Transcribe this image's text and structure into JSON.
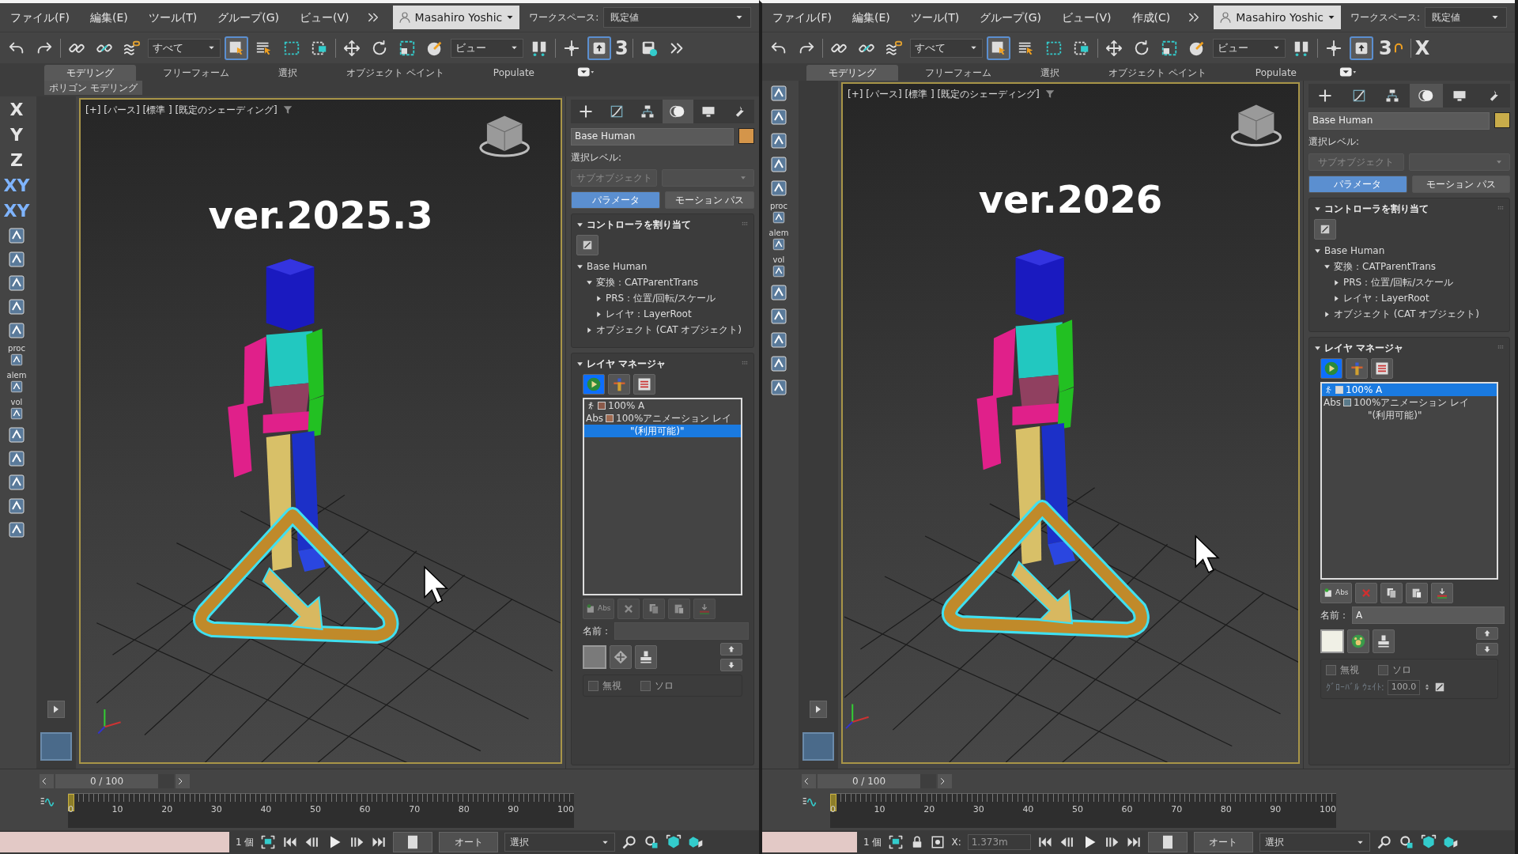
{
  "panes": [
    {
      "menu": [
        "ファイル(F)",
        "編集(E)",
        "ツール(T)",
        "グループ(G)",
        "ビュー(V)"
      ],
      "user": "Masahiro Yoshic",
      "workspace_label": "ワークスペース:",
      "workspace_value": "既定値",
      "toolbar": [
        {
          "kind": "undo"
        },
        {
          "kind": "redo"
        },
        {
          "kind": "sep"
        },
        {
          "kind": "link"
        },
        {
          "kind": "unlink"
        },
        {
          "kind": "bind"
        },
        {
          "kind": "dropdown",
          "text": "すべて"
        },
        {
          "kind": "select",
          "selected": true
        },
        {
          "kind": "selectlist",
          "selected": false
        },
        {
          "kind": "rect",
          "selected": false
        },
        {
          "kind": "window",
          "selected": false
        },
        {
          "kind": "sep"
        },
        {
          "kind": "move",
          "selected": false
        },
        {
          "kind": "rotate",
          "selected": false
        },
        {
          "kind": "scale",
          "selected": false
        },
        {
          "kind": "place",
          "selected": false
        },
        {
          "kind": "dropdown",
          "text": "ビュー"
        },
        {
          "kind": "mirror"
        },
        {
          "kind": "sep"
        },
        {
          "kind": "align"
        },
        {
          "kind": "toggle",
          "selected": true
        },
        {
          "kind": "glyph",
          "text": "3"
        },
        {
          "kind": "sep"
        },
        {
          "kind": "save"
        },
        {
          "kind": "more"
        }
      ],
      "ribbon_tabs": [
        {
          "label": "モデリング",
          "selected": true
        },
        {
          "label": "フリーフォーム",
          "selected": false
        },
        {
          "label": "選択",
          "selected": false
        },
        {
          "label": "オブジェクト ペイント",
          "selected": false
        },
        {
          "label": "Populate",
          "selected": false
        }
      ],
      "ribbon_sub": "ポリゴン モデリング",
      "side_tools": [
        {
          "kind": "axis",
          "label": "X"
        },
        {
          "kind": "axis",
          "label": "Y"
        },
        {
          "kind": "axis",
          "label": "Z"
        },
        {
          "kind": "axis",
          "label": "XY"
        },
        {
          "kind": "axis",
          "label": "XY"
        },
        {
          "kind": "tool"
        },
        {
          "kind": "tool"
        },
        {
          "kind": "tool"
        },
        {
          "kind": "tool"
        },
        {
          "kind": "tool"
        },
        {
          "kind": "script",
          "label": "proc"
        },
        {
          "kind": "script",
          "label": "alem"
        },
        {
          "kind": "script",
          "label": "vol"
        },
        {
          "kind": "tool"
        },
        {
          "kind": "tool"
        },
        {
          "kind": "tool"
        },
        {
          "kind": "tool"
        },
        {
          "kind": "tool"
        }
      ],
      "viewport": {
        "label": "[+] [パース] [標準 ] [既定のシェーディング]",
        "version": "ver.2025.3"
      },
      "command_panel": {
        "tabs": [
          {
            "kind": "create",
            "selected": false
          },
          {
            "kind": "modify",
            "selected": false
          },
          {
            "kind": "hierarchy",
            "selected": false
          },
          {
            "kind": "motion",
            "selected": true
          },
          {
            "kind": "display",
            "selected": false
          },
          {
            "kind": "utilities",
            "selected": false
          }
        ],
        "object_name": "Base Human",
        "object_swatch": {
          "color": "#d4954a"
        },
        "selection_level_label": "選択レベル:",
        "subobject_button": "サブオブジェクト",
        "mode_buttons": [
          {
            "label": "パラメータ",
            "selected": true
          },
          {
            "label": "モーション パス",
            "selected": false
          }
        ],
        "controller_rollout": {
          "title": "コントローラを割り当て",
          "tree": [
            {
              "label": "Base Human",
              "expanded": true,
              "children": [
                {
                  "label": "変換：CATParentTrans",
                  "expanded": true,
                  "children": [
                    {
                      "label": "PRS：位置/回転/スケール",
                      "expanded": false
                    },
                    {
                      "label": "レイヤ：LayerRoot",
                      "expanded": false
                    }
                  ]
                },
                {
                  "label": "オブジェクト (CAT オブジェクト)",
                  "expanded": false
                }
              ]
            }
          ]
        },
        "layer_rollout": {
          "title": "レイヤ マネージャ",
          "layers": [
            {
              "kind": "run",
              "text": "100% A",
              "color": "#8b5a4a",
              "selected": false
            },
            {
              "kind": "abs",
              "tag": "Abs",
              "text": "100%アニメーション レイ",
              "color": "#a06a50",
              "selected": false
            },
            {
              "kind": "note",
              "text": "\"(利用可能)\"",
              "selected": true
            }
          ],
          "add_tag": "Abs",
          "enabled": false,
          "name_label": "名前：",
          "layer_swatch": {
            "color": "#7a7a7a"
          },
          "checks": [
            {
              "label": "無視",
              "checked": false
            },
            {
              "label": "ソロ",
              "checked": false
            }
          ]
        }
      },
      "timeline": {
        "frame": "0 / 100",
        "level": 0,
        "ticks": [
          "0",
          "10",
          "20",
          "30",
          "40",
          "50",
          "60",
          "70",
          "80",
          "90",
          "100"
        ]
      },
      "status": {
        "selection": "1 個",
        "key_mode": "オート",
        "key_filter": "選択"
      }
    },
    {
      "menu": [
        "ファイル(F)",
        "編集(E)",
        "ツール(T)",
        "グループ(G)",
        "ビュー(V)",
        "作成(C)"
      ],
      "user": "Masahiro Yoshic",
      "workspace_label": "ワークスペース:",
      "workspace_value": "既定値",
      "toolbar": [
        {
          "kind": "undo"
        },
        {
          "kind": "redo"
        },
        {
          "kind": "sep"
        },
        {
          "kind": "link"
        },
        {
          "kind": "unlink"
        },
        {
          "kind": "bind"
        },
        {
          "kind": "dropdown",
          "text": "すべて"
        },
        {
          "kind": "select",
          "selected": true
        },
        {
          "kind": "selectlist",
          "selected": false
        },
        {
          "kind": "rect",
          "selected": false
        },
        {
          "kind": "window",
          "selected": false
        },
        {
          "kind": "sep"
        },
        {
          "kind": "move",
          "selected": false
        },
        {
          "kind": "rotate",
          "selected": false
        },
        {
          "kind": "scale",
          "selected": false
        },
        {
          "kind": "place",
          "selected": false
        },
        {
          "kind": "dropdown",
          "text": "ビュー"
        },
        {
          "kind": "mirror"
        },
        {
          "kind": "sep"
        },
        {
          "kind": "align"
        },
        {
          "kind": "toggle",
          "selected": true
        },
        {
          "kind": "snap",
          "text": "3"
        },
        {
          "kind": "sep"
        },
        {
          "kind": "glyph",
          "text": "X"
        }
      ],
      "ribbon_tabs": [
        {
          "label": "モデリング",
          "selected": true
        },
        {
          "label": "フリーフォーム",
          "selected": false
        },
        {
          "label": "選択",
          "selected": false
        },
        {
          "label": "オブジェクト ペイント",
          "selected": false
        },
        {
          "label": "Populate",
          "selected": false
        }
      ],
      "side_tools": [
        {
          "kind": "tool"
        },
        {
          "kind": "tool"
        },
        {
          "kind": "tool"
        },
        {
          "kind": "tool"
        },
        {
          "kind": "tool"
        },
        {
          "kind": "script",
          "label": "proc"
        },
        {
          "kind": "script",
          "label": "alem"
        },
        {
          "kind": "script",
          "label": "vol"
        },
        {
          "kind": "tool"
        },
        {
          "kind": "tool"
        },
        {
          "kind": "tool"
        },
        {
          "kind": "tool"
        },
        {
          "kind": "tool"
        }
      ],
      "viewport": {
        "label": "[+] [パース] [標準 ] [既定のシェーディング]",
        "version": "ver.2026"
      },
      "command_panel": {
        "tabs": [
          {
            "kind": "create",
            "selected": false
          },
          {
            "kind": "modify",
            "selected": false
          },
          {
            "kind": "hierarchy",
            "selected": false
          },
          {
            "kind": "motion",
            "selected": true
          },
          {
            "kind": "display",
            "selected": false
          },
          {
            "kind": "utilities",
            "selected": false
          }
        ],
        "object_name": "Base Human",
        "object_swatch": {
          "color": "#c8ac4a"
        },
        "selection_level_label": "選択レベル:",
        "subobject_button": "サブオブジェクト",
        "mode_buttons": [
          {
            "label": "パラメータ",
            "selected": true
          },
          {
            "label": "モーション パス",
            "selected": false
          }
        ],
        "controller_rollout": {
          "title": "コントローラを割り当て",
          "tree": [
            {
              "label": "Base Human",
              "expanded": true,
              "children": [
                {
                  "label": "変換：CATParentTrans",
                  "expanded": true,
                  "children": [
                    {
                      "label": "PRS：位置/回転/スケール",
                      "expanded": false
                    },
                    {
                      "label": "レイヤ：LayerRoot",
                      "expanded": false
                    }
                  ]
                },
                {
                  "label": "オブジェクト (CAT オブジェクト)",
                  "expanded": false
                }
              ]
            }
          ]
        },
        "layer_rollout": {
          "title": "レイヤ マネージャ",
          "layers": [
            {
              "kind": "run",
              "text": "100% A",
              "color": "#d8d8d8",
              "selected": true
            },
            {
              "kind": "abs",
              "tag": "Abs",
              "text": "100%アニメーション レイ",
              "color": "#5a7a8a",
              "selected": false
            },
            {
              "kind": "note",
              "text": "\"(利用可能)\"",
              "selected": false
            }
          ],
          "add_tag": "Abs",
          "enabled": true,
          "name_label": "名前：",
          "name_value": "A",
          "layer_swatch": {
            "color": "#f0f0e6"
          },
          "checks": [
            {
              "label": "無視",
              "checked": false
            },
            {
              "label": "ソロ",
              "checked": false
            }
          ],
          "weight_label": "ｸﾞﾛｰﾊﾞﾙ ｳｪｲﾄ:",
          "weight_value": "100.0"
        }
      },
      "timeline": {
        "frame": "0 / 100",
        "level": 0,
        "ticks": [
          "0",
          "10",
          "20",
          "30",
          "40",
          "50",
          "60",
          "70",
          "80",
          "90",
          "100"
        ]
      },
      "status": {
        "selection": "1 個",
        "coord_label": "X:",
        "coord_value": "1.373m",
        "key_mode": "オート",
        "key_filter": "選択"
      }
    }
  ]
}
